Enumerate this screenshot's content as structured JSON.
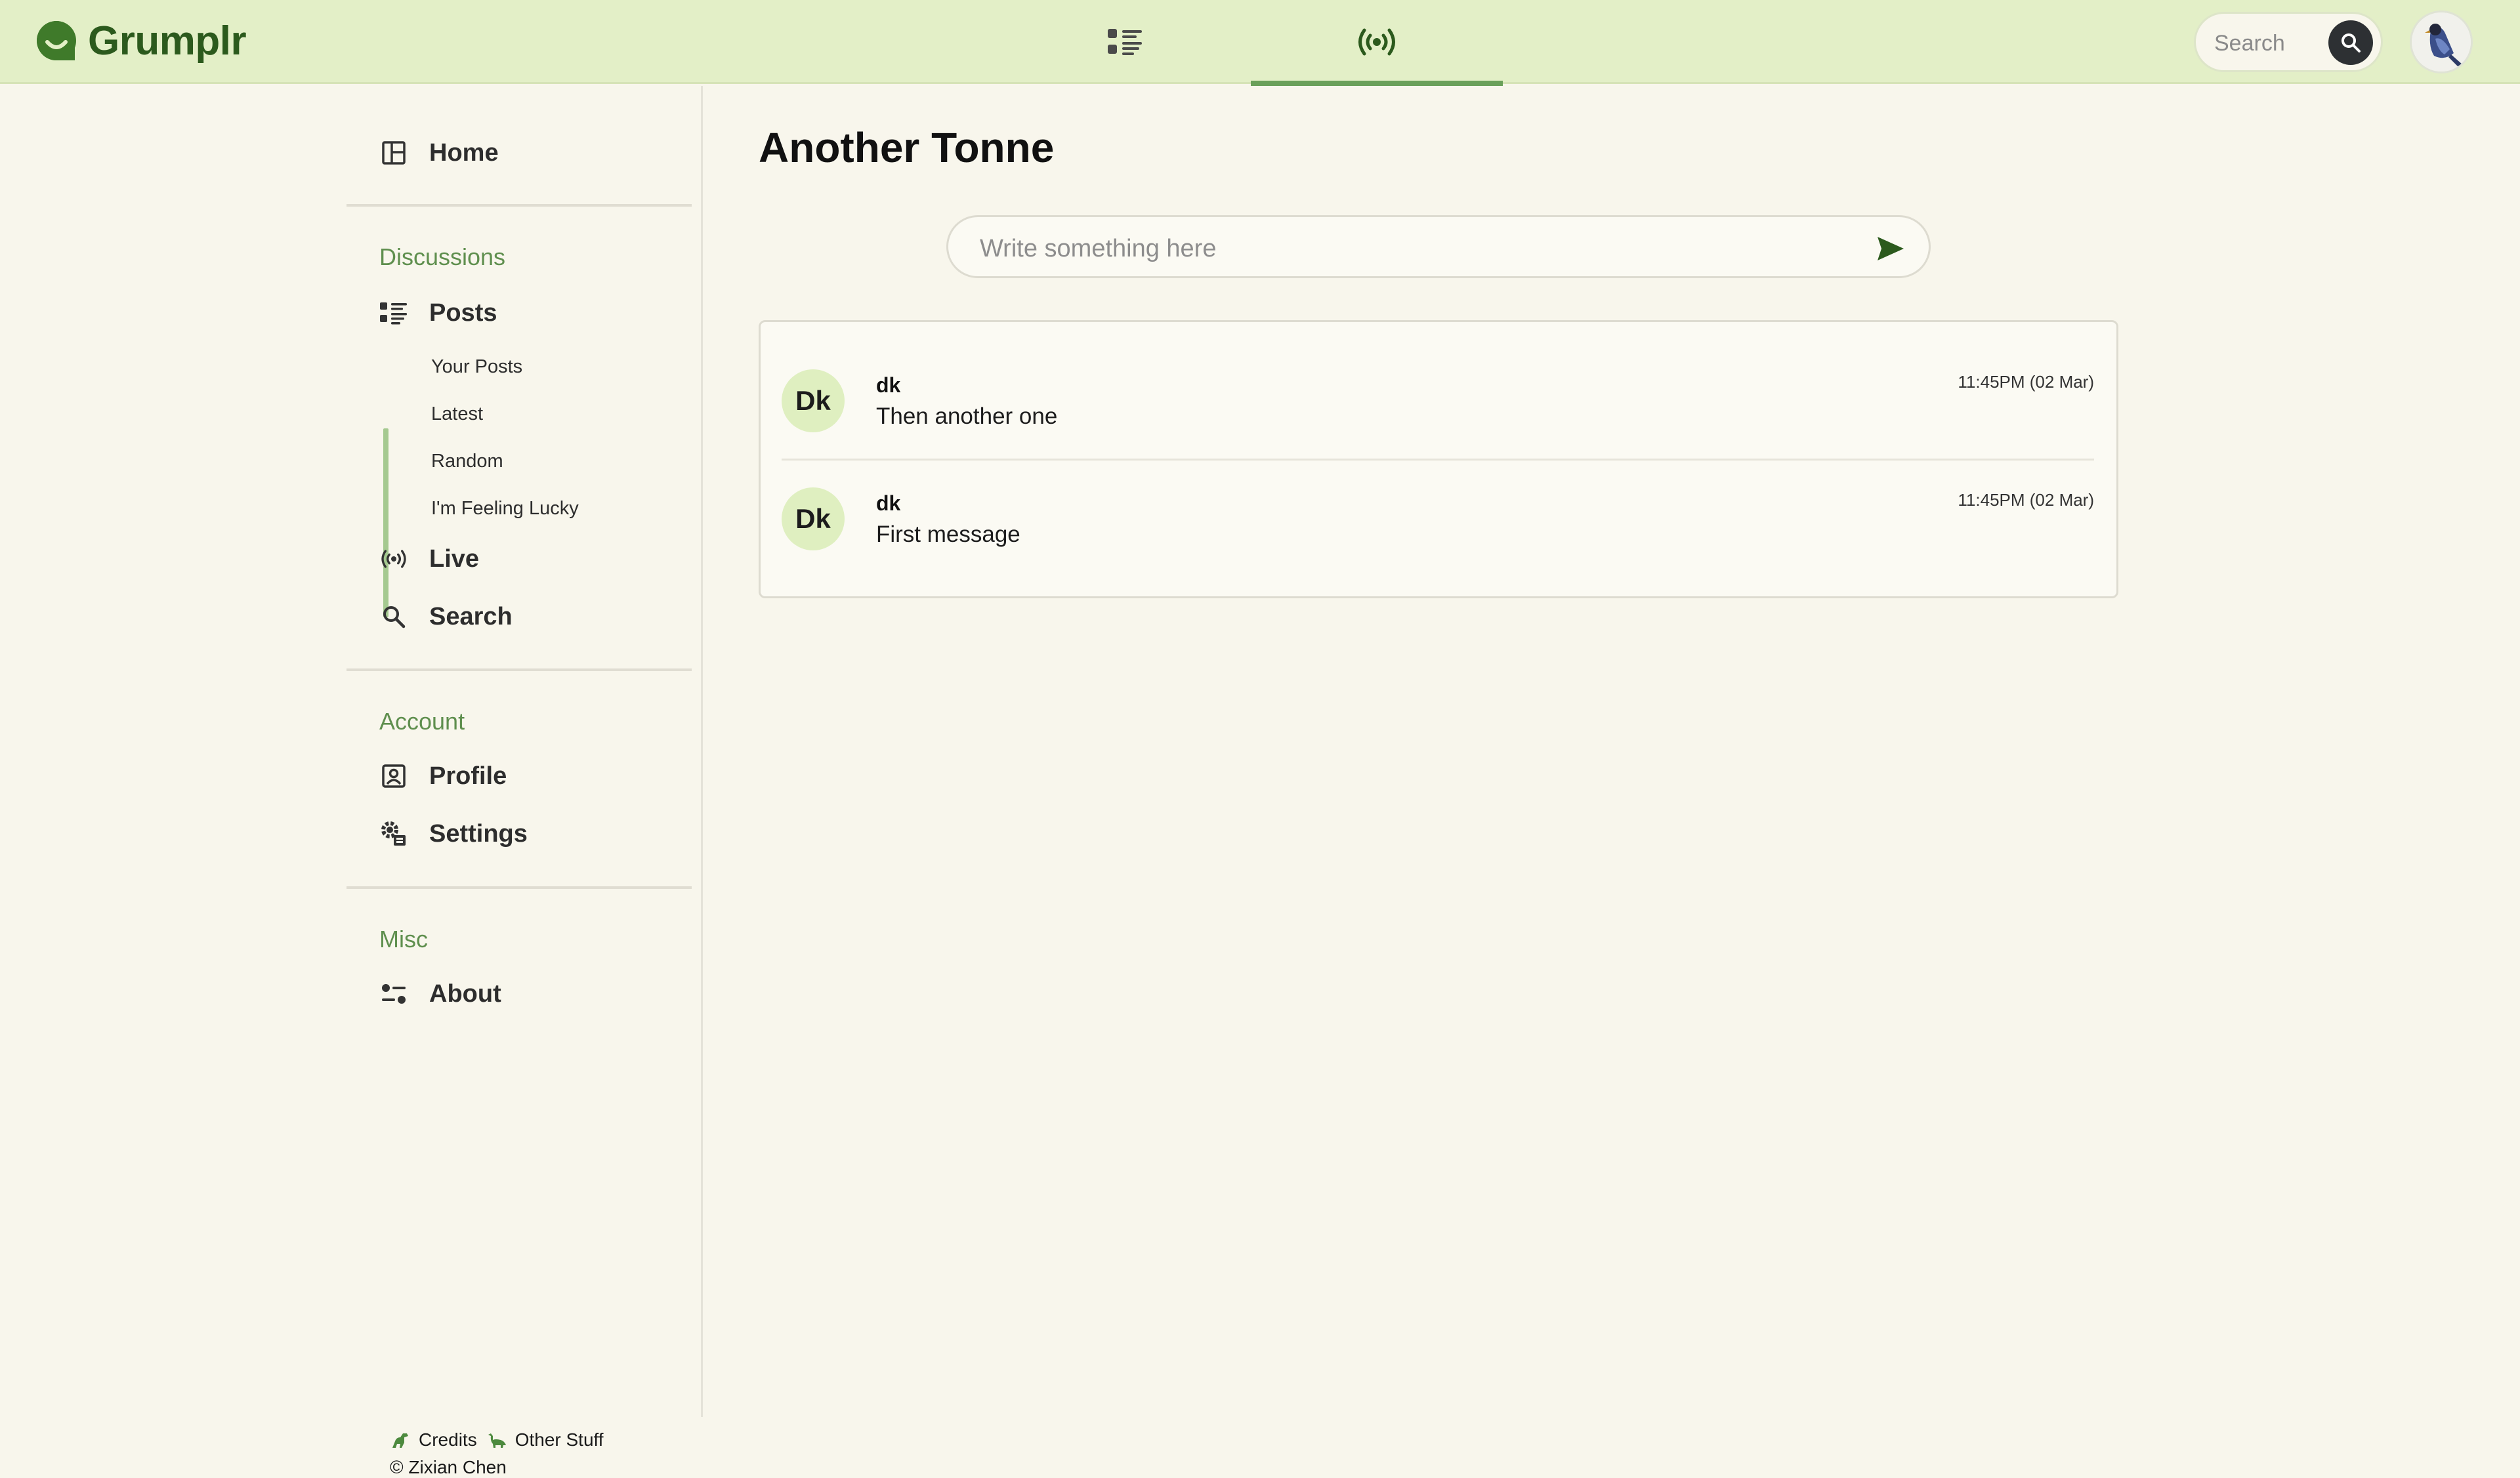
{
  "app": {
    "name": "Grumplr"
  },
  "header": {
    "tabs": [
      {
        "icon": "posts-list-icon"
      },
      {
        "icon": "live-broadcast-icon",
        "active": true
      }
    ],
    "search": {
      "placeholder": "Search"
    }
  },
  "sidebar": {
    "home_label": "Home",
    "discussions": {
      "title": "Discussions",
      "posts_label": "Posts",
      "sub_items": [
        "Your Posts",
        "Latest",
        "Random",
        "I'm Feeling Lucky"
      ],
      "live_label": "Live",
      "search_label": "Search"
    },
    "account": {
      "title": "Account",
      "profile_label": "Profile",
      "settings_label": "Settings"
    },
    "misc": {
      "title": "Misc",
      "about_label": "About"
    },
    "footer": {
      "credits_label": "Credits",
      "other_label": "Other Stuff",
      "copyright": "© Zixian Chen"
    }
  },
  "main": {
    "title": "Another Tonne",
    "composer": {
      "placeholder": "Write something here"
    },
    "messages": [
      {
        "initials": "Dk",
        "user": "dk",
        "text": "Then another one",
        "time": "11:45PM (02 Mar)"
      },
      {
        "initials": "Dk",
        "user": "dk",
        "text": "First message",
        "time": "11:45PM (02 Mar)"
      }
    ]
  },
  "colors": {
    "header_bg": "#e3efc7",
    "brand": "#2c5a1d",
    "accent": "#6aa05a",
    "section_title": "#5f8f4e",
    "avatar_bg": "#dfefc0",
    "page_bg": "#f8f6ec"
  }
}
